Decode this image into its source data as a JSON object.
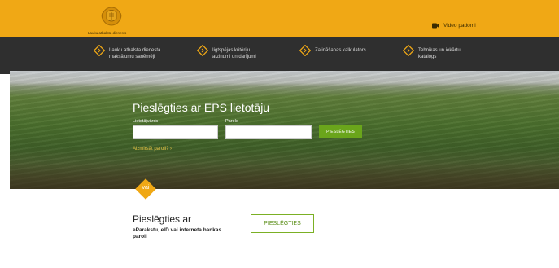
{
  "header": {
    "logo_text": "Lauku atbalsta dienests",
    "video_link_label": "Video padomi",
    "video_icon": "video-camera-icon"
  },
  "nav": {
    "items": [
      {
        "label_line1": "Lauku atbalsta dienesta",
        "label_line2": "maksājumu saņēmēji",
        "icon": "chevron-right-icon"
      },
      {
        "label_line1": "Iigtspējas kritēriju",
        "label_line2": "atzinumi un darījumi",
        "icon": "chevron-right-icon"
      },
      {
        "label_line1": "Zaļināšanas kalkulators",
        "label_line2": "",
        "icon": "chevron-right-icon"
      },
      {
        "label_line1": "Tehnikas un iekārtu",
        "label_line2": "katalogs",
        "icon": "chevron-right-icon"
      }
    ]
  },
  "login": {
    "title": "Pieslēgties ar EPS lietotāju",
    "username_label": "Lietotājvārds",
    "username_value": "",
    "password_label": "Parole",
    "password_value": "",
    "submit_label": "PIESLĒGTIES",
    "forgot_label": "Aizmirsāt paroli?  ›"
  },
  "alternative": {
    "separator_label": "vai",
    "title": "Pieslēgties ar",
    "subtitle": "eParakstu, eID vai interneta bankas paroli",
    "button_label": "PIESLĒGTIES"
  },
  "colors": {
    "accent": "#f0a815",
    "nav_bg": "#2f2f2f",
    "primary_button": "#6aa51b",
    "link": "#e9c545"
  }
}
